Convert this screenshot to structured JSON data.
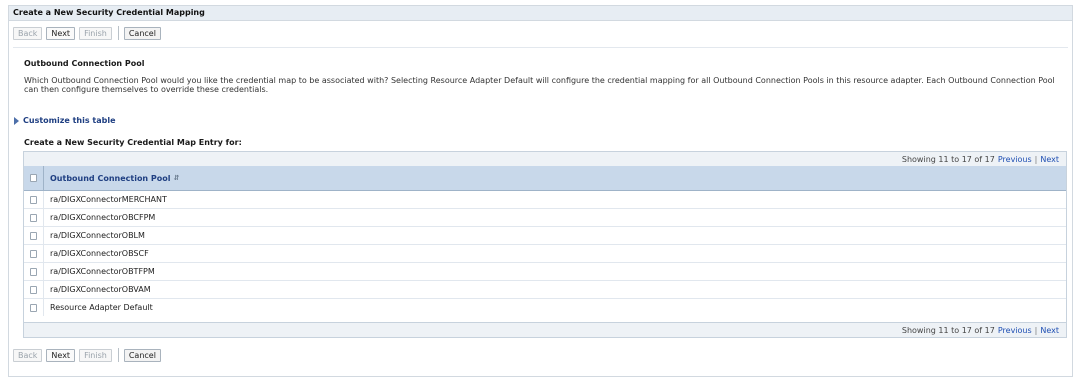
{
  "header": {
    "title": "Create a New Security Credential Mapping"
  },
  "buttons": {
    "back": "Back",
    "next": "Next",
    "finish": "Finish",
    "cancel": "Cancel"
  },
  "section": {
    "title": "Outbound Connection Pool",
    "description": "Which Outbound Connection Pool would you like the credential map to be associated with? Selecting Resource Adapter Default will configure the credential mapping for all Outbound Connection Pools in this resource adapter. Each Outbound Connection Pool can then configure themselves to override these credentials."
  },
  "customize_link": "Customize this table",
  "entry_title": "Create a New Security Credential Map Entry for:",
  "pager": {
    "showing": "Showing 11 to 17 of 17",
    "previous": "Previous",
    "separator": "|",
    "next": "Next"
  },
  "table": {
    "column_header": "Outbound Connection Pool",
    "rows": [
      "ra/DIGXConnectorMERCHANT",
      "ra/DIGXConnectorOBCFPM",
      "ra/DIGXConnectorOBLM",
      "ra/DIGXConnectorOBSCF",
      "ra/DIGXConnectorOBTFPM",
      "ra/DIGXConnectorOBVAM",
      "Resource Adapter Default"
    ]
  }
}
